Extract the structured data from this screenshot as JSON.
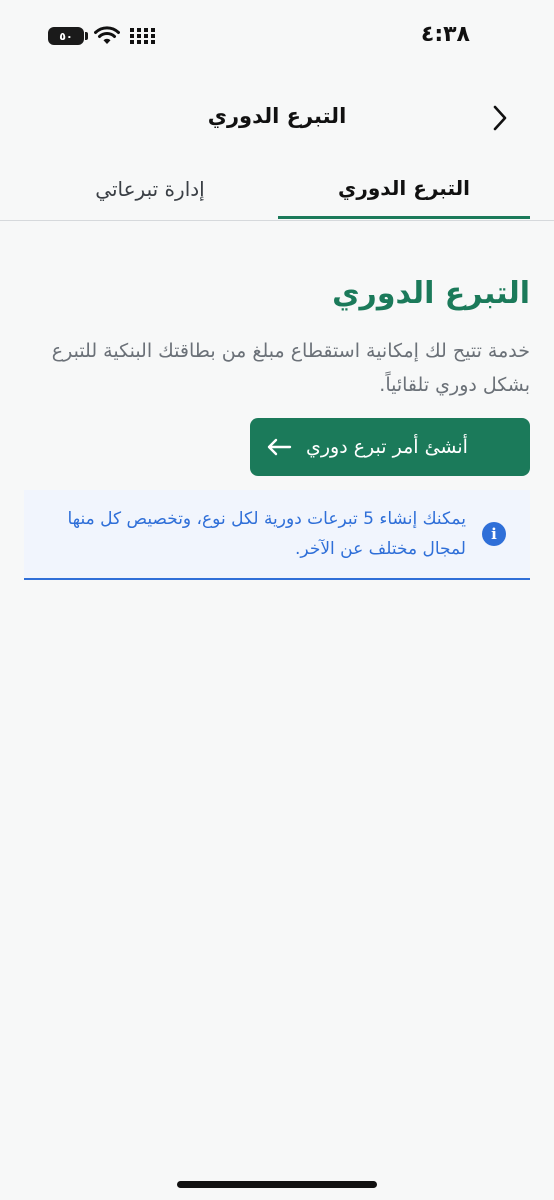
{
  "status_bar": {
    "time": "٤:٣٨",
    "battery": "٥٠"
  },
  "header": {
    "title": "التبرع الدوري"
  },
  "tabs": [
    {
      "label": "التبرع الدوري",
      "active": true
    },
    {
      "label": "إدارة تبرعاتي",
      "active": false
    }
  ],
  "main": {
    "heading": "التبرع الدوري",
    "description": "خدمة تتيح لك إمكانية استقطاع مبلغ من بطاقتك البنكية للتبرع بشكل دوري تلقائياً.",
    "cta_label": "أنشئ أمر تبرع دوري"
  },
  "info": {
    "text": "يمكنك إنشاء 5 تبرعات دورية لكل نوع، وتخصيص كل منها لمجال مختلف عن الآخر."
  },
  "colors": {
    "primary": "#1b7a5a",
    "info": "#2f6fd8",
    "muted": "#6b7178"
  }
}
